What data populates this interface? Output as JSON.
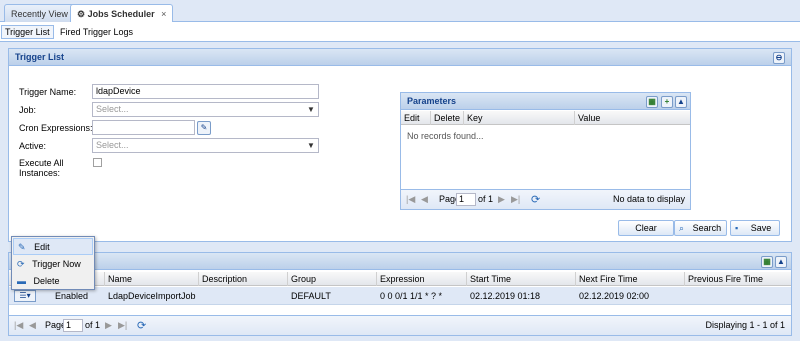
{
  "tabs": [
    {
      "label": "Recently View"
    },
    {
      "label": "Jobs Scheduler",
      "close": "×"
    }
  ],
  "subnav": {
    "trigger_list": "Trigger List",
    "fired_logs": "Fired Trigger Logs"
  },
  "trigger_panel": {
    "title": "Trigger List",
    "form": {
      "trigger_name_label": "Trigger Name:",
      "trigger_name_value": "ldapDevice",
      "job_label": "Job:",
      "job_placeholder": "Select...",
      "cron_label": "Cron Expressions:",
      "cron_value": "",
      "active_label": "Active:",
      "active_placeholder": "Select...",
      "execute_all_label_1": "Execute All",
      "execute_all_label_2": "Instances:"
    },
    "parameters": {
      "title": "Parameters",
      "columns": [
        "Edit",
        "Delete",
        "Key",
        "Value"
      ],
      "empty_text": "No records found...",
      "pager": {
        "page_label": "Page",
        "page_value": "1",
        "of": "of 1",
        "status": "No data to display"
      }
    },
    "buttons": {
      "clear": "Clear",
      "search": "Search",
      "save": "Save"
    }
  },
  "results": {
    "columns": [
      "",
      "Name",
      "Description",
      "Group",
      "Expression",
      "Start Time",
      "Next Fire Time",
      "Previous Fire Time"
    ],
    "row": {
      "status": "Enabled",
      "name": "LdapDeviceImportJob",
      "description": "",
      "group": "DEFAULT",
      "expression": "0 0 0/1 1/1 * ? *",
      "start_time": "02.12.2019 01:18",
      "next_fire_time": "02.12.2019 02:00",
      "previous_fire_time": ""
    },
    "pager": {
      "page_label": "Page",
      "page_value": "1",
      "of": "of 1",
      "status": "Displaying 1 - 1 of 1"
    }
  },
  "context_menu": {
    "items": [
      {
        "label": "Edit",
        "icon": "pencil-icon"
      },
      {
        "label": "Trigger Now",
        "icon": "refresh-icon"
      },
      {
        "label": "Delete",
        "icon": "delete-icon"
      }
    ]
  },
  "colors": {
    "accent": "#15428b",
    "border": "#99bbe8",
    "header_bg": "#dae6f4"
  }
}
